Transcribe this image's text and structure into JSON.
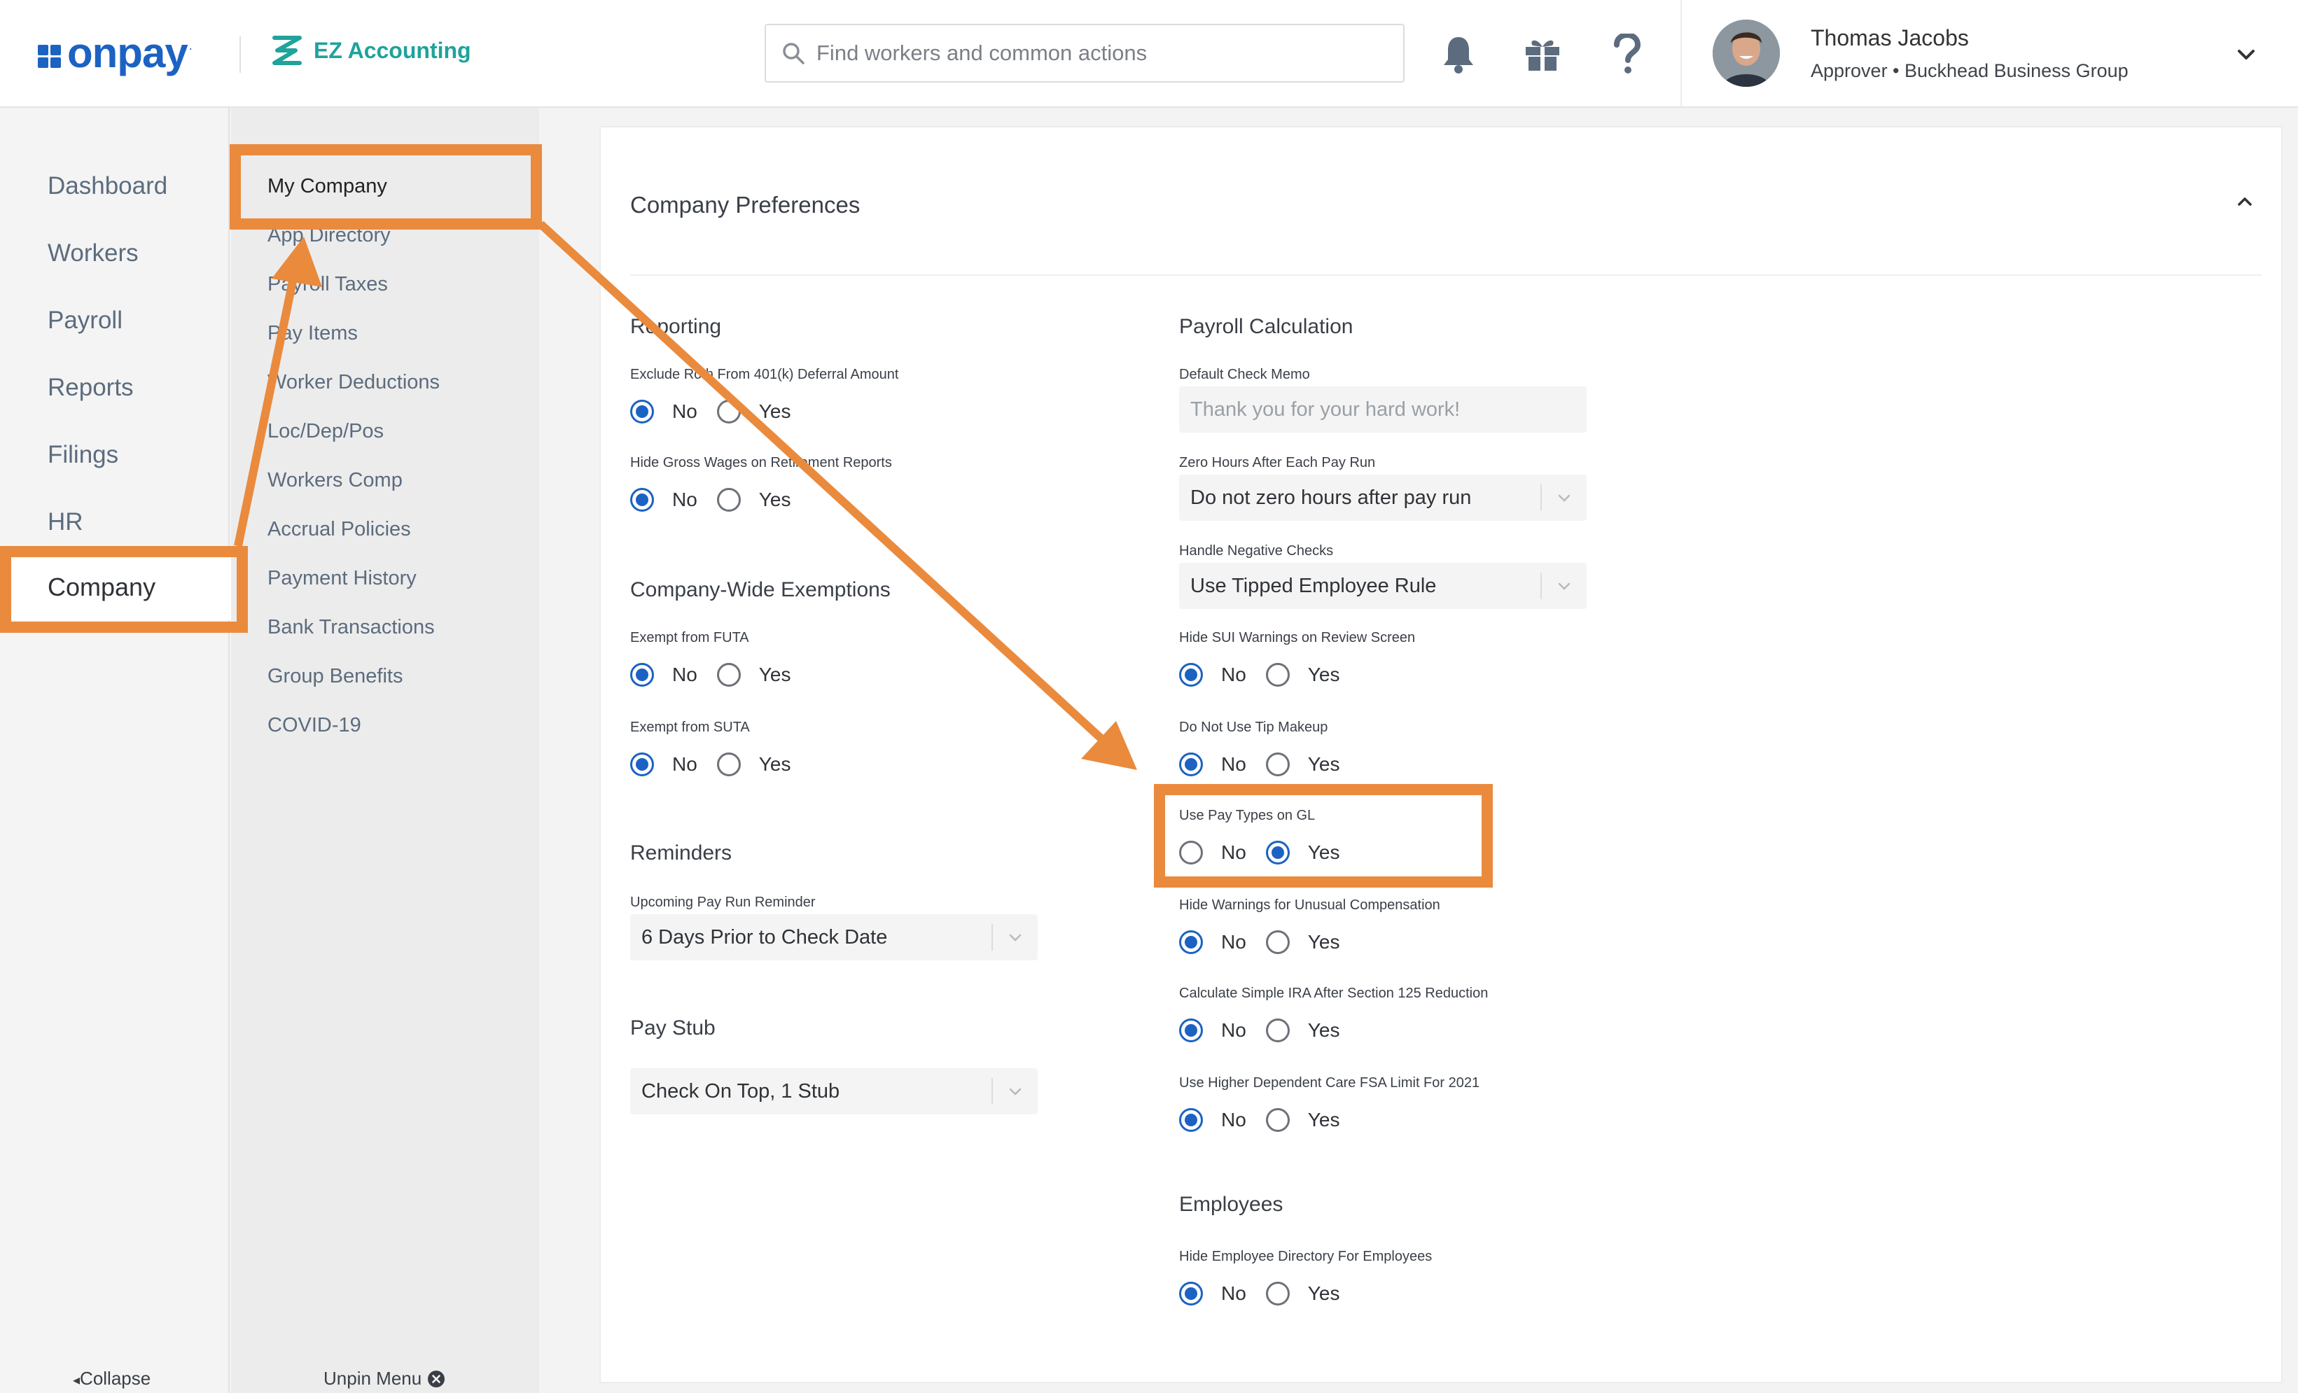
{
  "header": {
    "logo_text": "onpay",
    "logo_mark": ".",
    "partner_name": "EZ Accounting",
    "search_placeholder": "Find workers and common actions",
    "user_name": "Thomas Jacobs",
    "user_role": "Approver • Buckhead Business Group",
    "icons": [
      "bell-icon",
      "gift-icon",
      "help-icon",
      "chevron-down-icon"
    ]
  },
  "nav": {
    "items": [
      {
        "label": "Dashboard"
      },
      {
        "label": "Workers"
      },
      {
        "label": "Payroll"
      },
      {
        "label": "Reports"
      },
      {
        "label": "Filings"
      },
      {
        "label": "HR"
      },
      {
        "label": "Company"
      }
    ],
    "collapse_label": "Collapse"
  },
  "subnav": {
    "items": [
      {
        "label": "My Company"
      },
      {
        "label": "App Directory"
      },
      {
        "label": "Payroll Taxes"
      },
      {
        "label": "Pay Items"
      },
      {
        "label": "Worker Deductions"
      },
      {
        "label": "Loc/Dep/Pos"
      },
      {
        "label": "Workers Comp"
      },
      {
        "label": "Accrual Policies"
      },
      {
        "label": "Payment History"
      },
      {
        "label": "Bank Transactions"
      },
      {
        "label": "Group Benefits"
      },
      {
        "label": "COVID-19"
      }
    ],
    "unpin_label": "Unpin Menu"
  },
  "main": {
    "card_title": "Company Preferences",
    "options": {
      "no": "No",
      "yes": "Yes"
    },
    "reporting": {
      "title": "Reporting",
      "fields": [
        {
          "label": "Exclude Roth From 401(k) Deferral Amount",
          "value": "No"
        },
        {
          "label": "Hide Gross Wages on Retirement Reports",
          "value": "No"
        }
      ]
    },
    "exemptions": {
      "title": "Company-Wide Exemptions",
      "fields": [
        {
          "label": "Exempt from FUTA",
          "value": "No"
        },
        {
          "label": "Exempt from SUTA",
          "value": "No"
        }
      ]
    },
    "reminders": {
      "title": "Reminders",
      "upcoming_label": "Upcoming Pay Run Reminder",
      "upcoming_value": "6 Days Prior to Check Date"
    },
    "paystub": {
      "title": "Pay Stub",
      "value": "Check On Top, 1 Stub"
    },
    "payroll_calc": {
      "title": "Payroll Calculation",
      "memo_label": "Default Check Memo",
      "memo_placeholder": "Thank you for your hard work!",
      "zero_hours_label": "Zero Hours After Each Pay Run",
      "zero_hours_value": "Do not zero hours after pay run",
      "negative_label": "Handle Negative Checks",
      "negative_value": "Use Tipped Employee Rule",
      "fields": [
        {
          "label": "Hide SUI Warnings on Review Screen",
          "value": "No"
        },
        {
          "label": "Do Not Use Tip Makeup",
          "value": "No"
        },
        {
          "label": "Use Pay Types on GL",
          "value": "Yes"
        },
        {
          "label": "Hide Warnings for Unusual Compensation",
          "value": "No"
        },
        {
          "label": "Calculate Simple IRA After Section 125 Reduction",
          "value": "No"
        },
        {
          "label": "Use Higher Dependent Care FSA Limit For 2021",
          "value": "No"
        }
      ]
    },
    "employees": {
      "title": "Employees",
      "fields": [
        {
          "label": "Hide Employee Directory For Employees",
          "value": "No"
        }
      ]
    }
  },
  "colors": {
    "brand_blue": "#1c62c3",
    "partner_teal": "#1fa39b",
    "annotation_orange": "#ea8a3d"
  }
}
